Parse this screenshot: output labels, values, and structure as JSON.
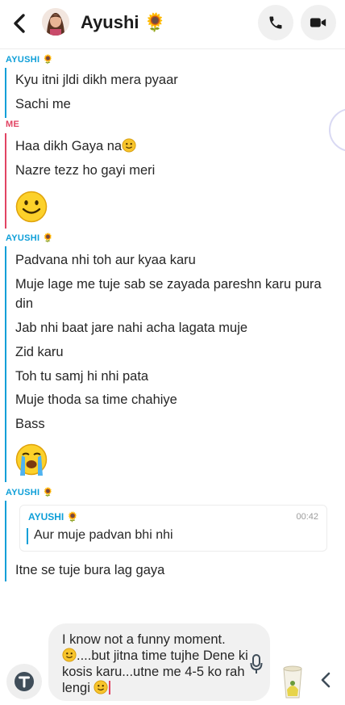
{
  "header": {
    "title": "Ayushi 🌻",
    "back_icon": "chevron-left-icon",
    "call_icon": "phone-icon",
    "video_icon": "video-camera-icon"
  },
  "colors": {
    "her": "#0e9fd8",
    "me": "#e24463",
    "text": "#262626",
    "bubble": "#f1f1f1"
  },
  "messages": {
    "group1": {
      "sender": "AYUSHI 🌻",
      "lines": [
        "Kyu itni jldi dikh mera pyaar",
        "Sachi me"
      ]
    },
    "group2": {
      "sender": "ME",
      "lines": [
        "Haa dikh Gaya na",
        "Nazre tezz ho gayi meri"
      ],
      "emoji": "smiling-face-icon"
    },
    "group3": {
      "sender": "AYUSHI 🌻",
      "lines": [
        "Padvana nhi toh aur kyaa karu",
        "Muje lage me tuje sab se zayada pareshn karu pura din",
        "Jab nhi baat jare nahi acha lagata muje",
        "Zid karu",
        "Toh tu samj hi nhi pata",
        "Muje thoda sa time chahiye",
        "Bass"
      ],
      "emoji": "loudly-crying-face-icon"
    },
    "group4": {
      "sender": "AYUSHI 🌻",
      "reply": {
        "name": "AYUSHI 🌻",
        "time": "00:42",
        "text": "Aur muje padvan bhi nhi"
      },
      "lines": [
        "Itne se tuje bura lag gaya"
      ]
    }
  },
  "composer": {
    "text_part1": "I know not a funny moment.",
    "text_part2": "....but jitna time tujhe Dene ki kosis karu...utne me 4-5 ko rah lengi",
    "bitmoji_icon": "bitmoji-typing-icon",
    "text_tool_icon": "text-t-icon",
    "mic_icon": "microphone-icon",
    "sticker_icon": "cup-sticker-icon",
    "expand_icon": "chevron-left-icon"
  }
}
